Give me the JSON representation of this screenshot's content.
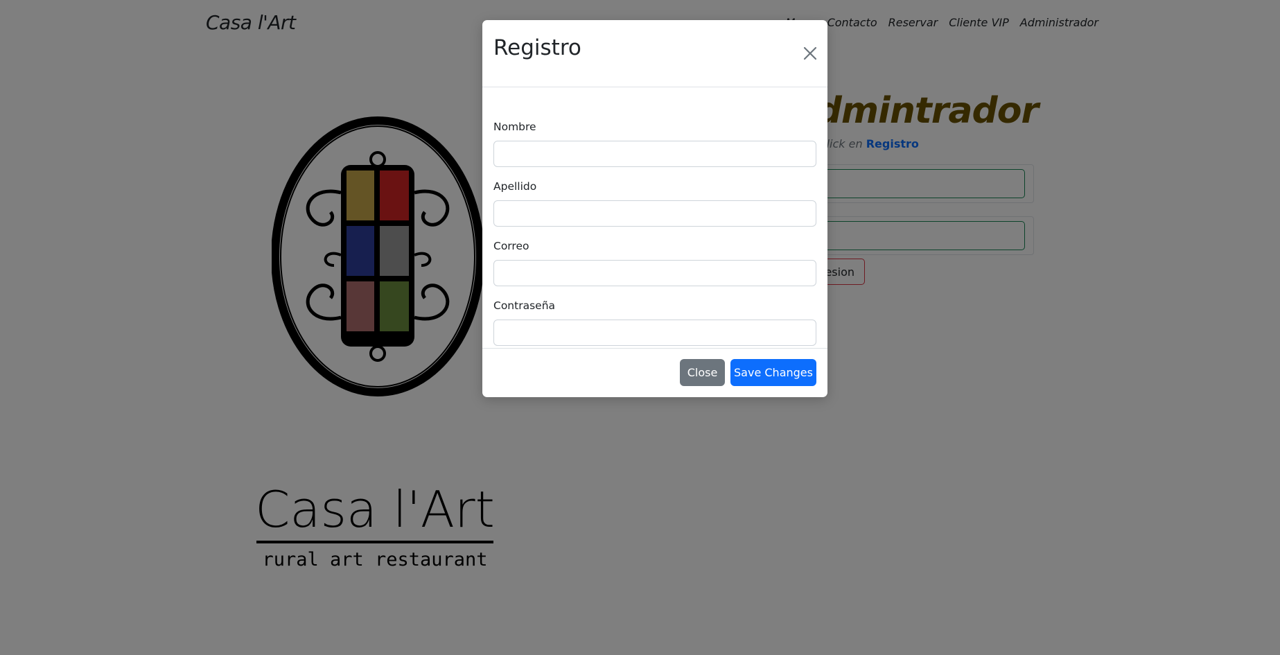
{
  "navbar": {
    "brand": "Casa l'Art",
    "links": [
      "Menu",
      "Contacto",
      "Reservar",
      "Cliente VIP",
      "Administrador"
    ]
  },
  "background": {
    "admin_title": "Admintrador",
    "hint_prefix": "...ta Click en",
    "hint_link": "Registro",
    "login_button": "...sesion",
    "logo_text_line1": "Casa l'Art",
    "logo_text_line2": "rural art restaurant"
  },
  "modal": {
    "title": "Registro",
    "fields": [
      {
        "label": "Nombre",
        "value": ""
      },
      {
        "label": "Apellido",
        "value": ""
      },
      {
        "label": "Correo",
        "value": ""
      },
      {
        "label": "Contraseña",
        "value": ""
      }
    ],
    "close_button": "Close",
    "save_button": "Save Changes"
  },
  "colors": {
    "primary": "#0d6efd",
    "secondary": "#6c757d",
    "admin_title": "#6b5200",
    "backdrop": "rgba(0,0,0,0.5)"
  }
}
